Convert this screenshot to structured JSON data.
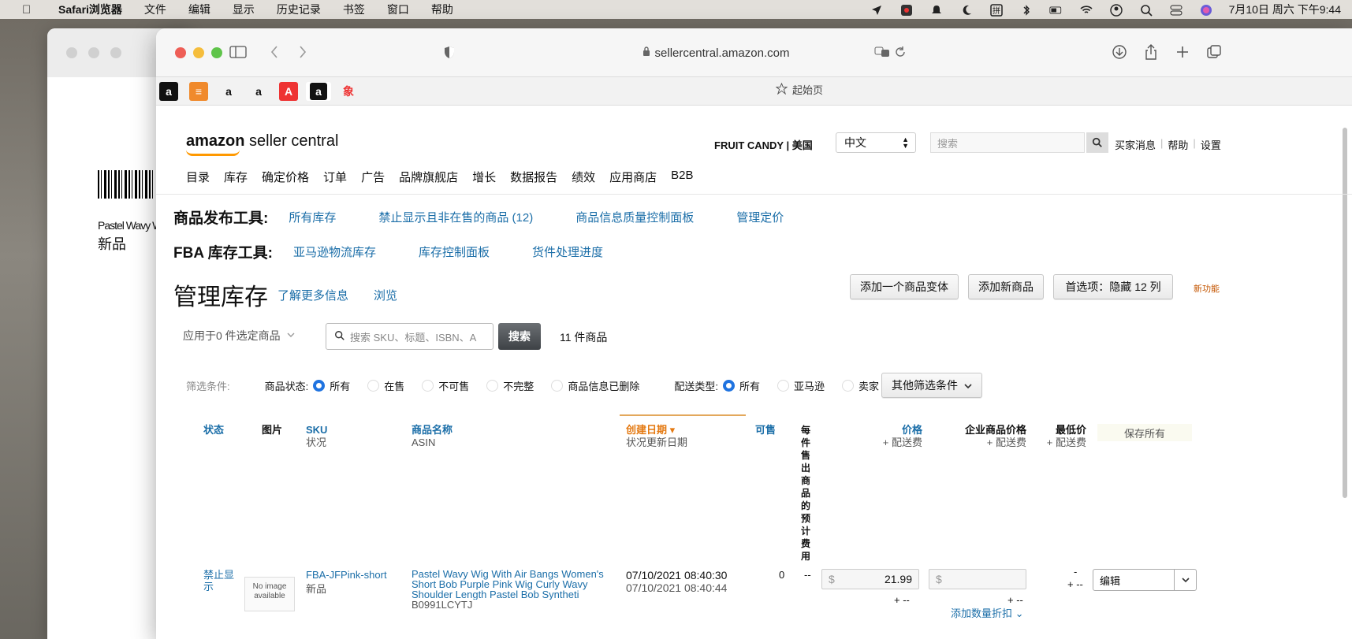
{
  "menubar": {
    "app": "Safari浏览器",
    "items": [
      "文件",
      "编辑",
      "显示",
      "历史记录",
      "书签",
      "窗口",
      "帮助"
    ],
    "clock": "7月10日 周六 下午9:44"
  },
  "background_window": {
    "label": "Pastel Wavy W",
    "condition": "新品"
  },
  "browser": {
    "url": "sellercentral.amazon.com",
    "start_page": "起始页",
    "favorites": [
      "a",
      "≡",
      "a",
      "a",
      "A",
      "a",
      "象"
    ]
  },
  "header": {
    "logo_bold": "amazon",
    "logo_rest": " seller central",
    "store": "FRUIT CANDY | 美国",
    "language": "中文",
    "search_placeholder": "搜索",
    "links": [
      "买家消息",
      "帮助",
      "设置"
    ]
  },
  "nav": [
    "目录",
    "库存",
    "确定价格",
    "订单",
    "广告",
    "品牌旗舰店",
    "增长",
    "数据报告",
    "绩效",
    "应用商店",
    "B2B"
  ],
  "tools": {
    "listing_title": "商品发布工具:",
    "listing_links": [
      "所有库存",
      "禁止显示且非在售的商品 (12)",
      "商品信息质量控制面板",
      "管理定价"
    ],
    "fba_title": "FBA 库存工具:",
    "fba_links": [
      "亚马逊物流库存",
      "库存控制面板",
      "货件处理进度"
    ]
  },
  "page": {
    "title": "管理库存",
    "learn_more": "了解更多信息",
    "browse": "浏览",
    "buttons": {
      "add_variation": "添加一个商品变体",
      "add_product": "添加新商品",
      "preferences": "首选项：隐藏 12 列"
    },
    "new_feature": "新功能",
    "apply_to": "应用于0 件选定商品",
    "search_placeholder": "搜索 SKU、标题、ISBN、A",
    "search_button": "搜索",
    "count": "11 件商品"
  },
  "filters": {
    "label": "筛选条件:",
    "status_label": "商品状态:",
    "status_options": [
      "所有",
      "在售",
      "不可售",
      "不完整",
      "商品信息已删除"
    ],
    "fulfillment_label": "配送类型:",
    "fulfillment_options": [
      "所有",
      "亚马逊",
      "卖家"
    ],
    "more": "其他筛选条件"
  },
  "table": {
    "headers": {
      "status": "状态",
      "image": "图片",
      "sku": "SKU",
      "sku_sub": "状况",
      "name": "商品名称",
      "name_sub": "ASIN",
      "created": "创建日期",
      "created_sub": "状况更新日期",
      "available": "可售",
      "fee_vertical": "每件售出商品的预计费用",
      "price": "价格",
      "price_sub": "+ 配送费",
      "business_price": "企业商品价格",
      "business_sub": "+ 配送费",
      "min_price": "最低价",
      "min_sub": "+ 配送费",
      "save_all": "保存所有"
    },
    "rows": [
      {
        "status": "禁止显示",
        "image_text": "No image available",
        "sku": "FBA-JFPink-short",
        "condition": "新品",
        "name": "Pastel Wavy Wig With Air Bangs Women's Short Bob Purple Pink Wig Curly Wavy Shoulder Length Pastel Bob Syntheti",
        "asin": "B0991LCYTJ",
        "created": "07/10/2021 08:40:30",
        "updated": "07/10/2021 08:40:44",
        "available": "0",
        "fee": "--",
        "currency": "$",
        "price": "21.99",
        "price_plus": "+ --",
        "business_currency": "$",
        "business_plus": "+ --",
        "add_discount": "添加数量折扣",
        "min_dash": "-",
        "min_plus": "+ --",
        "edit": "编辑"
      }
    ]
  }
}
